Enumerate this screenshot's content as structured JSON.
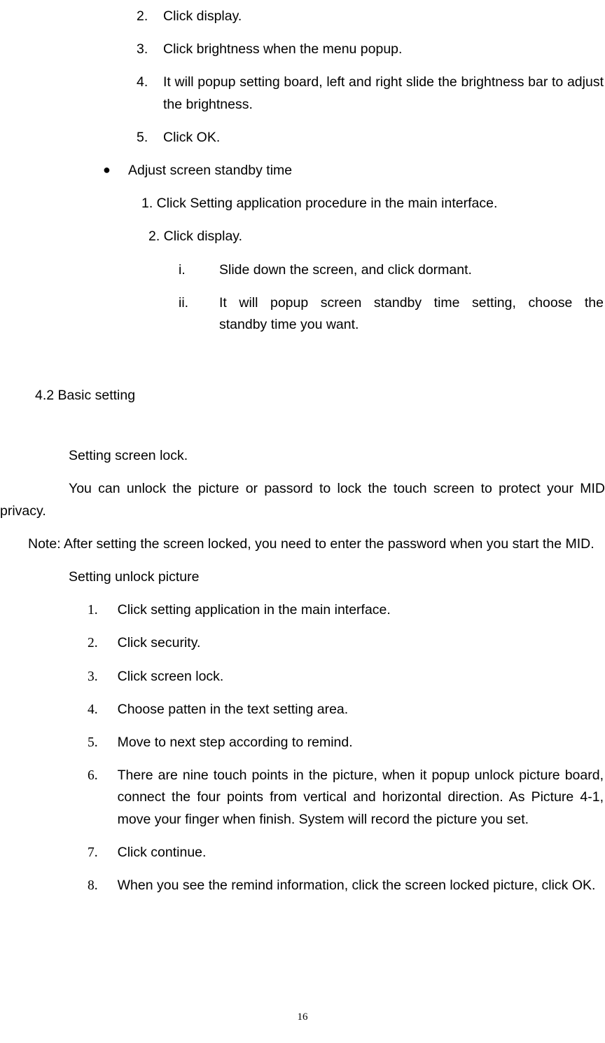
{
  "topList": [
    {
      "num": "2.",
      "text": "Click display."
    },
    {
      "num": "3.",
      "text": "Click brightness when the menu popup."
    },
    {
      "num": "4.",
      "text": "It will popup setting board, left and right slide the brightness bar to adjust the brightness."
    },
    {
      "num": "5.",
      "text": "Click OK."
    }
  ],
  "bulletText": "Adjust screen standby time",
  "subNum1": "1. Click Setting application procedure in the main interface.",
  "subNum2": "2. Click display.",
  "romanList": [
    {
      "rn": "i.",
      "text": "Slide down the screen, and click dormant."
    },
    {
      "rn": "ii.",
      "text": "It will popup screen standby time setting, choose the standby time you want."
    }
  ],
  "sectionHeading": "4.2 Basic setting",
  "paraTitle": "Setting screen lock.",
  "paraBody": "You can unlock the picture or passord to lock the touch screen to protect your MID privacy.",
  "paraNote": "Note: After setting the screen locked, you need to enter the password when you start the MID.",
  "subHeading": "Setting unlock picture",
  "bottomList": [
    {
      "num": "1.",
      "text": "Click setting application in the main interface."
    },
    {
      "num": "2.",
      "text": "Click security."
    },
    {
      "num": "3.",
      "text": "Click screen lock."
    },
    {
      "num": "4.",
      "text": "Choose patten in the text setting area."
    },
    {
      "num": "5.",
      "text": "Move to next step according to remind."
    },
    {
      "num": "6.",
      "text": "There are nine touch points in the picture, when it popup unlock picture board, connect the four points from vertical and horizontal direction. As Picture 4-1, move your finger when finish. System will record the picture you set."
    },
    {
      "num": "7.",
      "text": "Click continue."
    },
    {
      "num": "8.",
      "text": "When you see the remind information, click the screen locked picture, click OK."
    }
  ],
  "pageNum": "16"
}
